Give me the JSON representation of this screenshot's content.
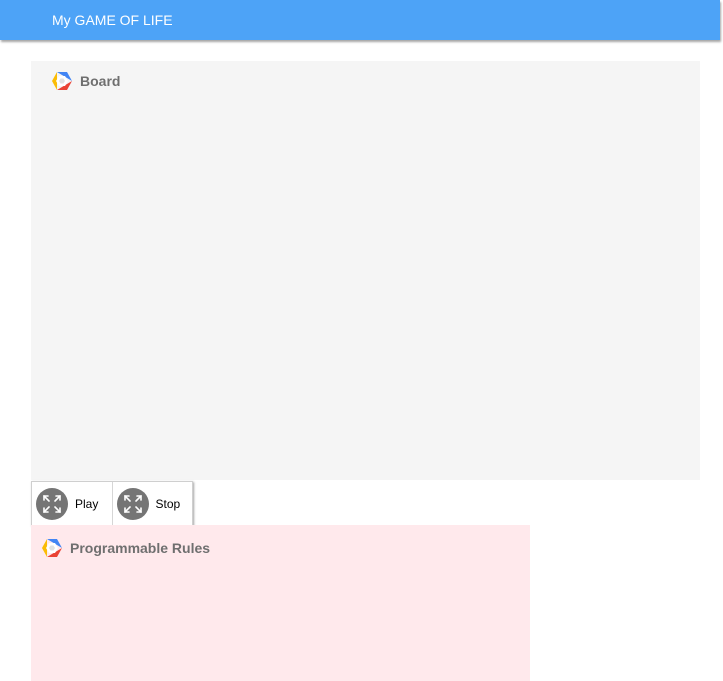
{
  "header": {
    "title": "My GAME OF LIFE"
  },
  "board_panel": {
    "title": "Board",
    "icon": "google-cloud-hexagon-icon"
  },
  "controls": {
    "play_label": "Play",
    "stop_label": "Stop",
    "icon": "expand-arrows-icon"
  },
  "rules_panel": {
    "title": "Programmable Rules",
    "icon": "google-cloud-hexagon-icon"
  },
  "colors": {
    "header_bg": "#4da3f7",
    "board_bg": "#f5f5f5",
    "rules_bg": "#ffe9ec",
    "control_icon_bg": "#757575"
  }
}
